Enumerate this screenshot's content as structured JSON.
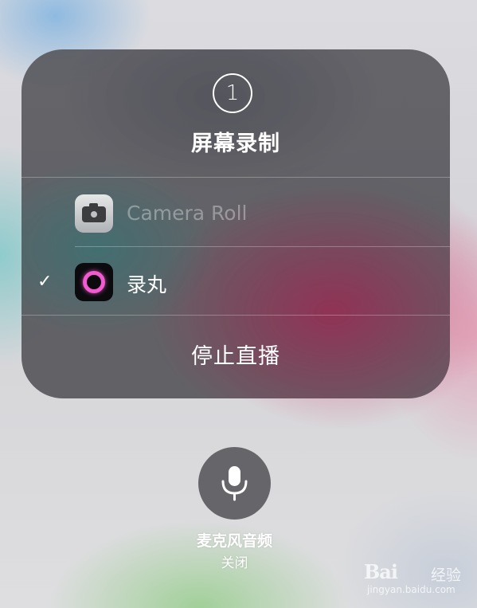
{
  "panel": {
    "step_number": "1",
    "title": "屏幕录制",
    "options": [
      {
        "label": "Camera Roll",
        "icon": "camera-icon",
        "selected": false,
        "enabled": false
      },
      {
        "label": "录丸",
        "icon": "app-icon",
        "selected": true,
        "enabled": true,
        "check": "✓"
      }
    ],
    "stop_label": "停止直播"
  },
  "microphone": {
    "icon": "microphone-icon",
    "title": "麦克风音频",
    "status": "关闭"
  },
  "watermark": {
    "brand": "Bai",
    "suffix": "经验",
    "url": "jingyan.baidu.com"
  },
  "colors": {
    "app_ring": "#f25ad0",
    "panel_bg": "#5a5a60",
    "text": "#ffffff"
  }
}
